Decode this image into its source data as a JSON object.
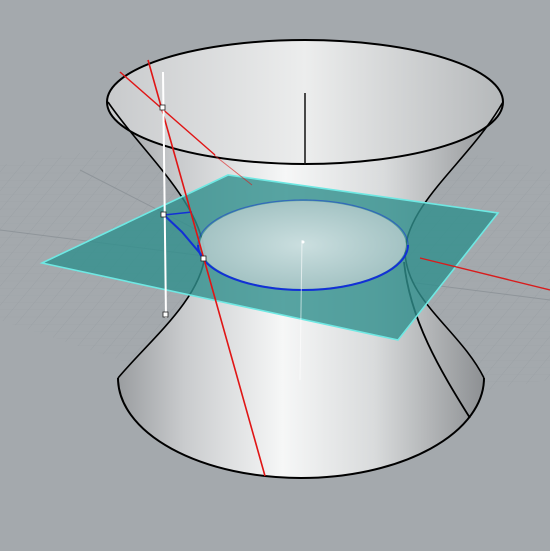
{
  "viewport": {
    "view_name": "",
    "background_color": "#a4a9ad"
  },
  "scene": {
    "objects": [
      {
        "name": "construction-grid",
        "kind": "grid",
        "color": "#9aa0a5"
      },
      {
        "name": "hyperboloid-of-one-sheet",
        "kind": "surface",
        "color": "#d7d9da",
        "edge_color": "#000000"
      },
      {
        "name": "cutting-plane",
        "kind": "plane",
        "color": "#2f8f8c",
        "edge_color": "#6fe8e3",
        "opacity": 0.8
      },
      {
        "name": "intersection-ellipse",
        "kind": "curve",
        "color": "#1230d6"
      },
      {
        "name": "axis-line",
        "kind": "line",
        "color": "#111111"
      },
      {
        "name": "ruling-lines",
        "kind": "line",
        "color": "#e01515"
      },
      {
        "name": "x-axis-indicator",
        "kind": "line",
        "color": "#d81c1c"
      },
      {
        "name": "gumball-vertical",
        "kind": "control",
        "color": "#ffffff"
      }
    ]
  }
}
